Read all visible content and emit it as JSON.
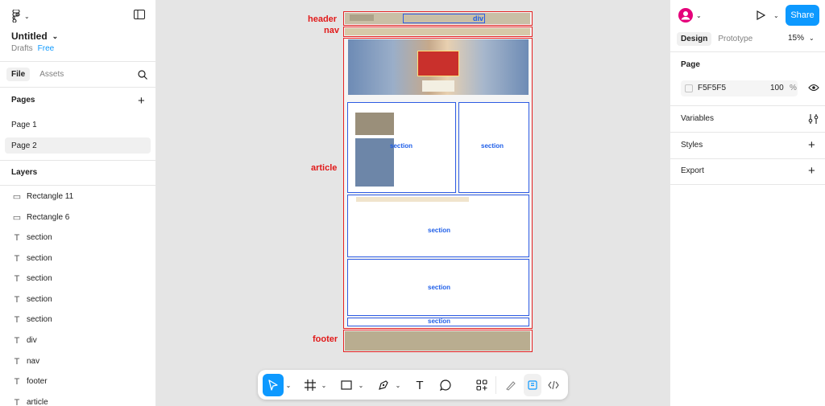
{
  "left_panel": {
    "file_title": "Untitled",
    "drafts": "Drafts",
    "plan_badge": "Free",
    "tabs": [
      "File",
      "Assets"
    ],
    "pages_title": "Pages",
    "pages": [
      "Page 1",
      "Page 2"
    ],
    "layers_title": "Layers",
    "layers": [
      {
        "name": "Rectangle 11",
        "icon": "rectangle-icon"
      },
      {
        "name": "Rectangle 6",
        "icon": "rectangle-icon"
      },
      {
        "name": "section",
        "icon": "text-icon"
      },
      {
        "name": "section",
        "icon": "text-icon"
      },
      {
        "name": "section",
        "icon": "text-icon"
      },
      {
        "name": "section",
        "icon": "text-icon"
      },
      {
        "name": "section",
        "icon": "text-icon"
      },
      {
        "name": "div",
        "icon": "text-icon"
      },
      {
        "name": "nav",
        "icon": "text-icon"
      },
      {
        "name": "footer",
        "icon": "text-icon"
      },
      {
        "name": "article",
        "icon": "text-icon"
      }
    ]
  },
  "right_panel": {
    "share_label": "Share",
    "tabs": [
      "Design",
      "Prototype"
    ],
    "zoom": "15%",
    "page_title": "Page",
    "page_color": "F5F5F5",
    "page_opacity": "100",
    "percent": "%",
    "sections": [
      "Variables",
      "Styles",
      "Export"
    ]
  },
  "canvas": {
    "labels": {
      "header": "header",
      "nav": "nav",
      "article": "article",
      "footer": "footer",
      "div": "div",
      "section": "section"
    }
  },
  "colors": {
    "accent": "#0d99ff",
    "annotation_red": "#e52222",
    "annotation_blue": "#2d5be3",
    "avatar": "#e5007a"
  },
  "help": "?"
}
